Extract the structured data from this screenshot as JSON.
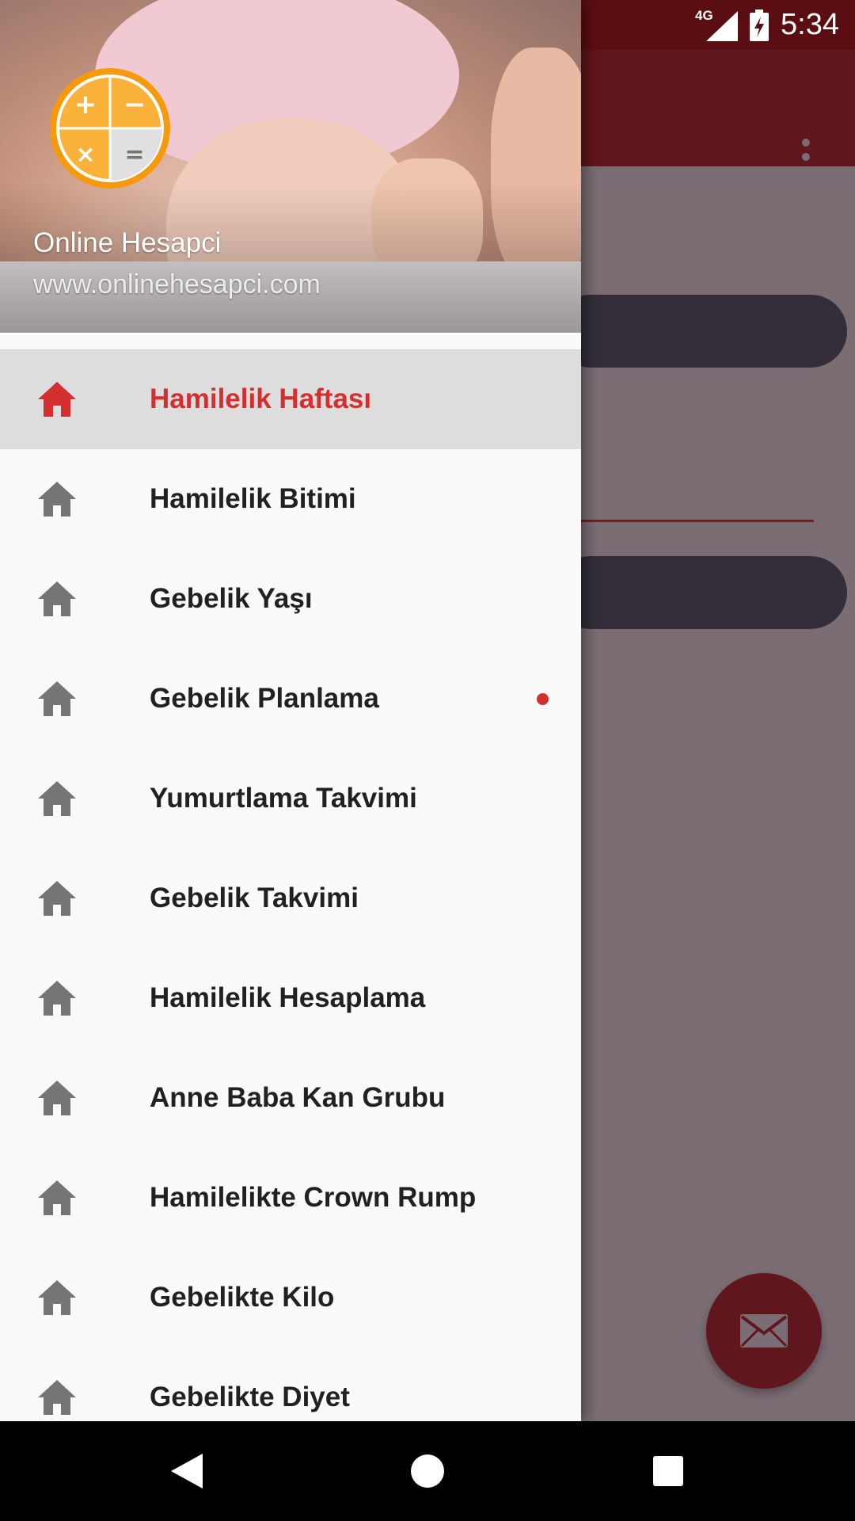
{
  "status_bar": {
    "time": "5:34",
    "network": "4G",
    "sd_card_icon": "sd-card-icon",
    "signal_icon": "signal-icon",
    "battery_icon": "battery-charging-icon"
  },
  "drawer": {
    "header": {
      "title": "Online Hesapci",
      "subtitle": "www.onlinehesapci.com",
      "logo_icon": "calculator-logo-icon"
    },
    "items": [
      {
        "label": "Hamilelik Haftası",
        "icon": "home-icon",
        "selected": true
      },
      {
        "label": "Hamilelik Bitimi",
        "icon": "home-icon"
      },
      {
        "label": "Gebelik Yaşı",
        "icon": "home-icon"
      },
      {
        "label": "Gebelik Planlama",
        "icon": "home-icon",
        "badge": "new-dot"
      },
      {
        "label": "Yumurtlama Takvimi",
        "icon": "home-icon"
      },
      {
        "label": "Gebelik Takvimi",
        "icon": "home-icon"
      },
      {
        "label": "Hamilelik Hesaplama",
        "icon": "home-icon"
      },
      {
        "label": "Anne Baba Kan Grubu",
        "icon": "home-icon"
      },
      {
        "label": "Hamilelikte Crown Rump",
        "icon": "home-icon"
      },
      {
        "label": "Gebelikte Kilo",
        "icon": "home-icon"
      },
      {
        "label": "Gebelikte Diyet",
        "icon": "home-icon"
      }
    ]
  },
  "app": {
    "overflow_icon": "more-vert-icon",
    "fab_icon": "mail-icon"
  },
  "nav_bar": {
    "back_icon": "back-icon",
    "home_icon": "home-circle-icon",
    "recents_icon": "recents-icon"
  },
  "colors": {
    "primary": "#b71c1c",
    "accent_selected": "#d32f2f",
    "icon_gray": "#757575",
    "logo_orange": "#f59a0c"
  }
}
